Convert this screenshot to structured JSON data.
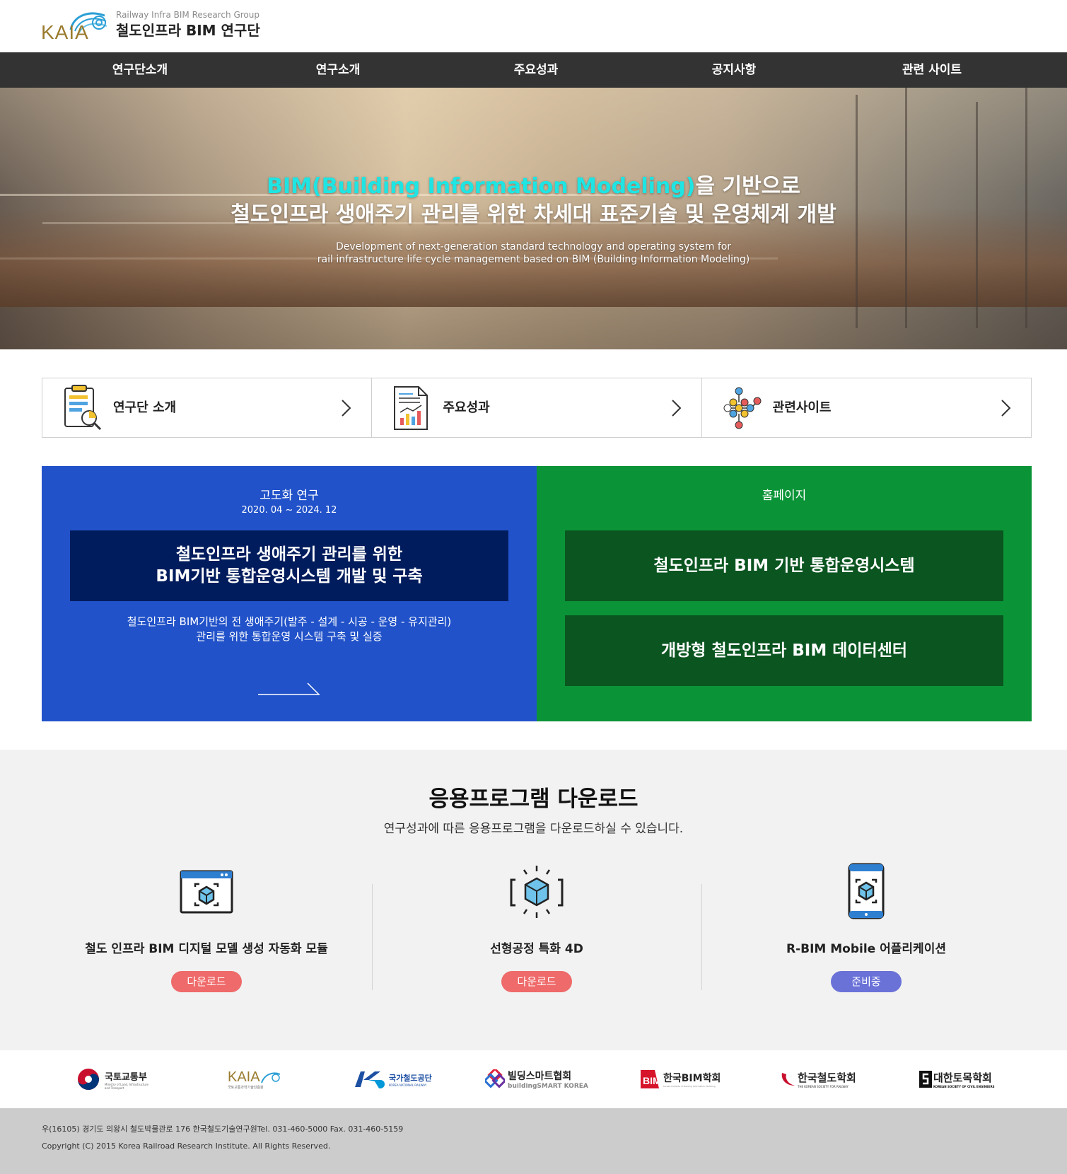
{
  "header": {
    "logo_word": "KAIA",
    "subtitle_en": "Railway Infra BIM Research Group",
    "title_ko": "철도인프라 BIM 연구단",
    "brand_colors": {
      "logo_gold": "#9a7b2e",
      "logo_blue": "#2b9fd6"
    }
  },
  "nav": {
    "items": [
      "연구단소개",
      "연구소개",
      "주요성과",
      "공지사항",
      "관련 사이트"
    ]
  },
  "hero": {
    "title_highlight": "BIM(Building Information Modeling)",
    "title_rest": "을 기반으로",
    "title_line2": "철도인프라 생애주기 관리를 위한 차세대 표준기술 및 운영체계 개발",
    "sub_line1": "Development of next-generation standard technology and operating system for",
    "sub_line2": "rail infrastructure life cycle management based on BIM (Building Information Modeling)",
    "highlight_color": "#1ee5e3"
  },
  "quick_links": [
    {
      "label": "연구단 소개",
      "icon": "clipboard-chart-icon"
    },
    {
      "label": "주요성과",
      "icon": "report-chart-icon"
    },
    {
      "label": "관련사이트",
      "icon": "network-nodes-icon"
    }
  ],
  "promo_blue": {
    "title": "고도화 연구",
    "date": "2020. 04 ~ 2024. 12",
    "box_line1": "철도인프라 생애주기 관리를 위한",
    "box_line2": "BIM기반 통합운영시스템 개발 및 구축",
    "desc_line1": "철도인프라 BIM기반의 전 생애주기(발주 - 설계 - 시공 - 운영 - 유지관리)",
    "desc_line2": "관리를 위한 통합운영 시스템 구축 및 실증",
    "color": "#2152c9"
  },
  "promo_green": {
    "title": "홈페이지",
    "link1": "철도인프라 BIM 기반 통합운영시스템",
    "link2": "개방형 철도인프라 BIM 데이터센터",
    "color": "#0b9437"
  },
  "downloads": {
    "heading": "응용프로그램 다운로드",
    "subheading": "연구성과에 따른 응용프로그램을 다운로드하실 수 있습니다.",
    "items": [
      {
        "name": "철도 인프라 BIM 디지털 모델 생성 자동화 모듈",
        "button": "다운로드",
        "icon": "browser-cube-icon",
        "button_color": "#ef6a6a"
      },
      {
        "name": "선형공정 특화 4D",
        "button": "다운로드",
        "icon": "scan-cube-icon",
        "button_color": "#ef6a6a"
      },
      {
        "name": "R-BIM Mobile 어플리케이션",
        "button": "준비중",
        "icon": "mobile-cube-icon",
        "button_color": "#6a72d8"
      }
    ]
  },
  "partners": [
    {
      "name": "국토교통부",
      "sub": "Ministry of Land, Infrastructure and Transport"
    },
    {
      "name": "KAIA",
      "sub": "국토교통과학기술진흥원"
    },
    {
      "name": "국가철도공단",
      "sub": "KOREA NATIONAL RAILWAY"
    },
    {
      "name": "빌딩스마트협회",
      "sub": "buildingSMART KOREA"
    },
    {
      "name": "한국BIM학회",
      "sub": "Korean Institute of Building Information Modeling"
    },
    {
      "name": "한국철도학회",
      "sub": "THE KOREAN SOCIETY FOR RAILWAY"
    },
    {
      "name": "대한토목학회",
      "sub": "KOREAN SOCIETY OF CIVIL ENGINEERS"
    }
  ],
  "footer": {
    "address": "우(16105) 경기도 의왕시 철도박물관로 176 한국철도기술연구원Tel. 031-460-5000 Fax. 031-460-5159",
    "copyright": "Copyright (C) 2015 Korea Railroad Research Institute. All Rights Reserved."
  }
}
